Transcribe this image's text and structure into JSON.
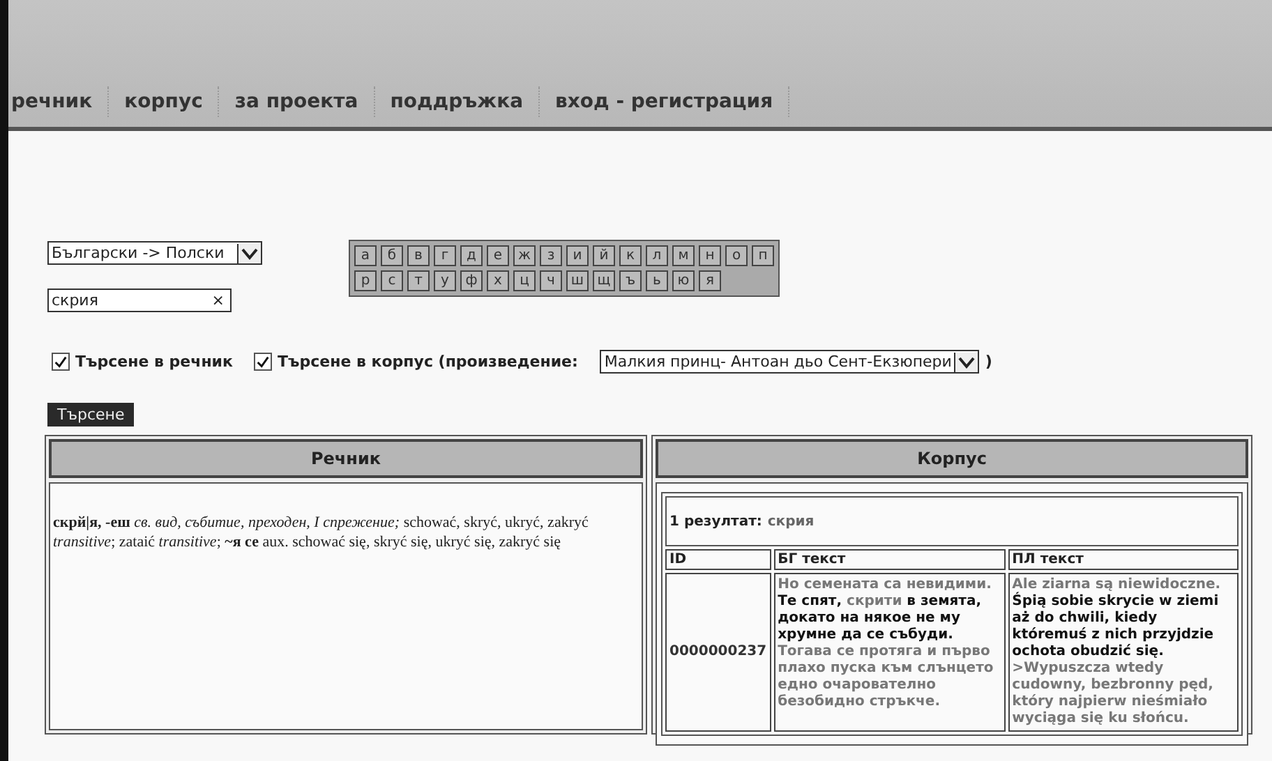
{
  "nav": [
    {
      "label": "речник",
      "selected": false
    },
    {
      "label": "корпус",
      "selected": false
    },
    {
      "label": "за проекта",
      "selected": false
    },
    {
      "label": "поддръжка",
      "selected": false
    },
    {
      "label": "вход - регистрация",
      "selected": false
    }
  ],
  "language_select": {
    "value": "Български -> Полски"
  },
  "search_field": {
    "value": "скрия",
    "clear": "×"
  },
  "alphabet": [
    "а",
    "б",
    "в",
    "г",
    "д",
    "е",
    "ж",
    "з",
    "и",
    "й",
    "к",
    "л",
    "м",
    "н",
    "о",
    "п",
    "р",
    "с",
    "т",
    "у",
    "ф",
    "х",
    "ц",
    "ч",
    "ш",
    "щ",
    "ъ",
    "ь",
    "ю",
    "я"
  ],
  "options": [
    {
      "label": "Търсене в речник",
      "checked": true
    },
    {
      "label": "Търсене в корпус (произведение:",
      "checked": true
    }
  ],
  "work_select": {
    "value": "Малкия принц- Антоан дьо Сент-Екзюпери"
  },
  "closing_paren": ")",
  "search_button": "Търсене",
  "dictionary": {
    "heading": "Речник",
    "entry": "**скрй|я, -еш** *св. вид, събитие, преходен, I спрежение;* schować, skryć, ukryć, zakryć *transitive*; zataić *transitive*; **~я се** aux. schować się, skryć się, ukryć się, zakryć się"
  },
  "corpus": {
    "heading": "Корпус",
    "result_label": "1 резултат:",
    "result_query": "скрия",
    "columns": [
      "ID",
      "БГ текст",
      "ПЛ текст"
    ],
    "rows": [
      {
        "id": "0000000237",
        "bg": [
          {
            "kind": "context",
            "text": "Но семената са невидими. "
          },
          {
            "kind": "match",
            "text": "Те спят, "
          },
          {
            "kind": "keyword",
            "text": "скрити"
          },
          {
            "kind": "match",
            "text": " в земята, докато на някое не му хрумне да се събуди. "
          },
          {
            "kind": "context",
            "text": "Тогава се протяга и първо плахо пуска към слънцето едно очарователно безобидно стръкче."
          }
        ],
        "pl": [
          {
            "kind": "context",
            "text": "Ale ziarna są niewidoczne. "
          },
          {
            "kind": "match",
            "text": "Śpią sobie skrycie w ziemi aż do chwili, kiedy któremuś z nich przyjdzie ochota obudzić się. "
          },
          {
            "kind": "context",
            "text": ">Wypuszcza wtedy cudowny, bezbronny pęd, który najpierw nieśmiało wyciąga się ku słońcu."
          }
        ]
      }
    ]
  }
}
